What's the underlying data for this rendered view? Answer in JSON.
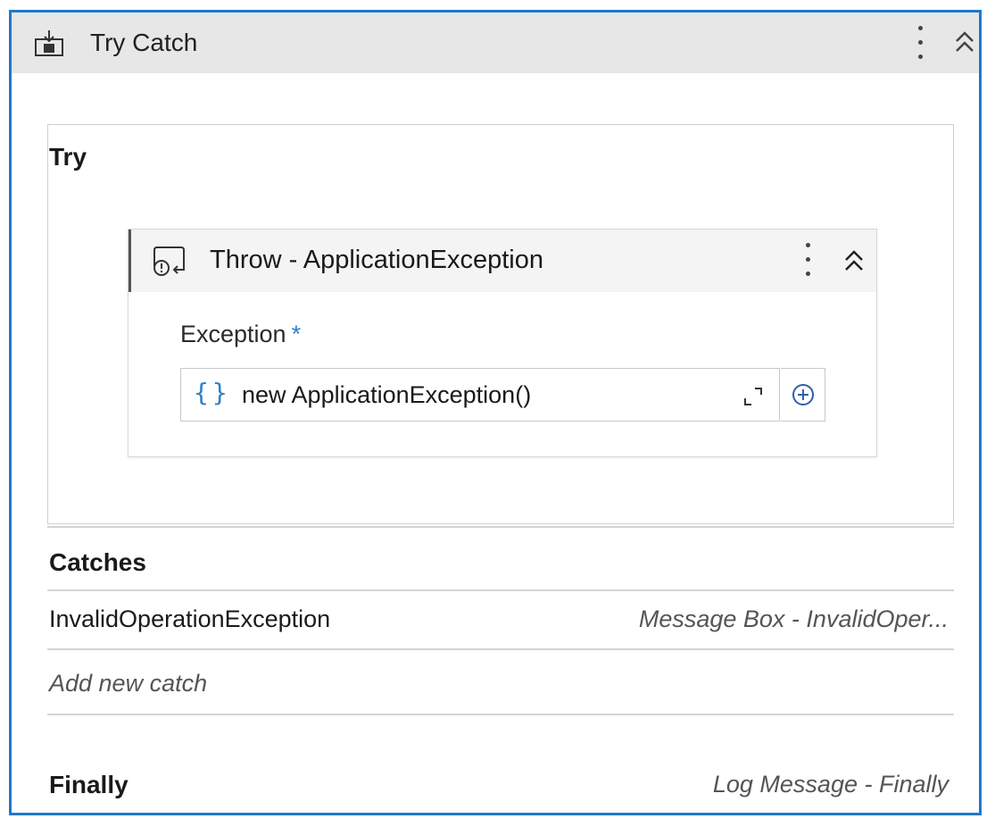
{
  "activity": {
    "title": "Try Catch",
    "header_icon": "try-catch-icon",
    "menu_icon": "more-vertical-icon",
    "collapse_icon": "collapse-up-icon"
  },
  "try_section": {
    "label": "Try",
    "throw_activity": {
      "title": "Throw - ApplicationException",
      "icon": "throw-icon",
      "field_label": "Exception",
      "required_mark": "*",
      "field_value": "new ApplicationException()",
      "expression_icon": "{}",
      "expand_icon": "expand-editor-icon",
      "plus_icon": "plus-circle-icon"
    }
  },
  "catches_section": {
    "label": "Catches",
    "items": [
      {
        "exception_type": "InvalidOperationException",
        "handler": "Message Box - InvalidOper..."
      }
    ],
    "add_new_label": "Add new catch"
  },
  "finally_section": {
    "label": "Finally",
    "handler": "Log Message - Finally"
  },
  "colors": {
    "accent": "#1f79c9",
    "header_bg": "#e7e7e7",
    "required": "#2f7fc9"
  }
}
